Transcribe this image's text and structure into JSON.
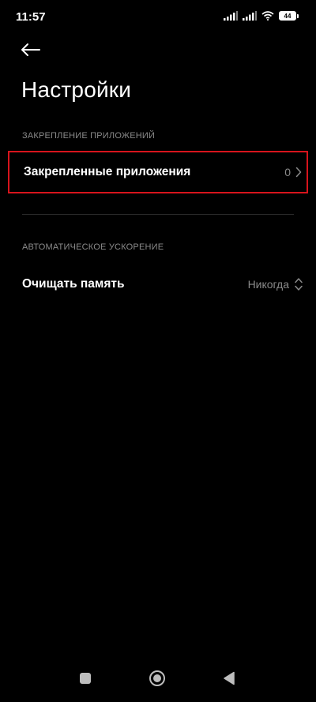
{
  "status_bar": {
    "time": "11:57",
    "battery": "44"
  },
  "header": {
    "title": "Настройки"
  },
  "sections": [
    {
      "header": "ЗАКРЕПЛЕНИЕ ПРИЛОЖЕНИЙ",
      "row": {
        "label": "Закрепленные приложения",
        "value": "0"
      }
    },
    {
      "header": "АВТОМАТИЧЕСКОЕ УСКОРЕНИЕ",
      "row": {
        "label": "Очищать память",
        "value": "Никогда"
      }
    }
  ],
  "colors": {
    "background": "#000000",
    "highlight": "#d7141c",
    "secondary_text": "#8a8a8a"
  },
  "icons": {
    "back": "arrow-left-icon",
    "chevron": "chevron-right-icon",
    "select": "up-down-chevron-icon",
    "nav_recent": "square-icon",
    "nav_home": "circle-icon",
    "nav_back": "triangle-left-icon"
  }
}
